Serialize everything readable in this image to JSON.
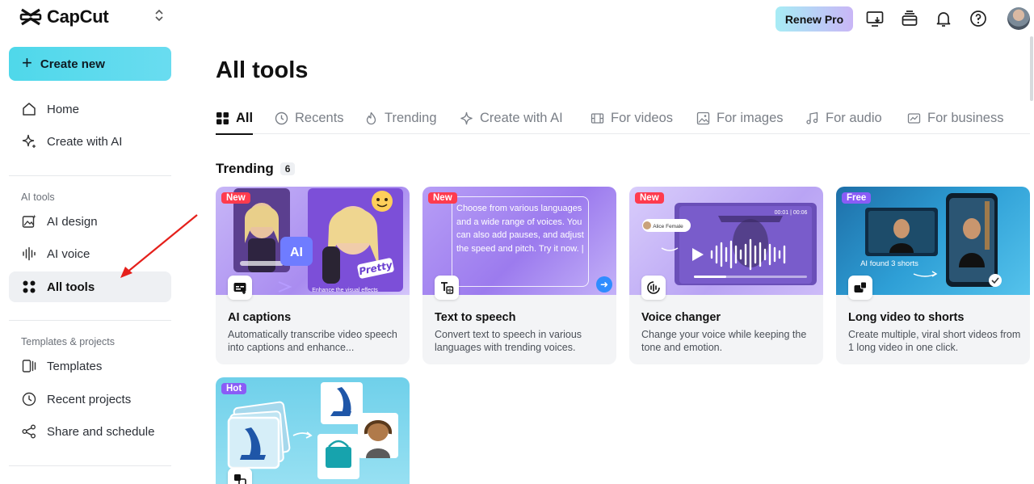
{
  "app": {
    "name": "CapCut"
  },
  "sidebar": {
    "create_label": "Create new",
    "items_top": [
      {
        "label": "Home",
        "icon": "home-icon"
      },
      {
        "label": "Create with AI",
        "icon": "sparkle-icon"
      }
    ],
    "ai_section": "AI tools",
    "ai_items": [
      {
        "label": "AI design",
        "icon": "image-sparkle-icon"
      },
      {
        "label": "AI voice",
        "icon": "waveform-icon"
      },
      {
        "label": "All tools",
        "icon": "grid-icon",
        "active": true
      }
    ],
    "templates_section": "Templates & projects",
    "template_items": [
      {
        "label": "Templates",
        "icon": "template-icon"
      },
      {
        "label": "Recent projects",
        "icon": "clock-icon"
      },
      {
        "label": "Share and schedule",
        "icon": "share-icon"
      }
    ]
  },
  "topbar": {
    "renew_label": "Renew Pro",
    "icons": [
      "download-monitor-icon",
      "stack-icon",
      "bell-icon",
      "help-icon",
      "avatar"
    ]
  },
  "main": {
    "title": "All tools",
    "tabs": [
      {
        "label": "All",
        "icon": "grid-icon",
        "active": true
      },
      {
        "label": "Recents",
        "icon": "clock-icon"
      },
      {
        "label": "Trending",
        "icon": "flame-icon"
      },
      {
        "label": "Create with AI",
        "icon": "sparkle-icon"
      },
      {
        "label": "For videos",
        "icon": "film-icon"
      },
      {
        "label": "For images",
        "icon": "image-icon"
      },
      {
        "label": "For audio",
        "icon": "music-icon"
      },
      {
        "label": "For business",
        "icon": "business-icon"
      }
    ],
    "section": {
      "title": "Trending",
      "count": "6"
    },
    "cards": [
      {
        "badge": "New",
        "title": "AI captions",
        "desc": "Automatically transcribe video speech into captions and enhance..."
      },
      {
        "badge": "New",
        "title": "Text to speech",
        "desc": "Convert text to speech in various languages with trending voices."
      },
      {
        "badge": "New",
        "title": "Voice changer",
        "desc": "Change your voice while keeping the tone and emotion."
      },
      {
        "badge": "Free",
        "title": "Long video to shorts",
        "desc": "Create multiple, viral short videos from 1 long video in one click."
      },
      {
        "badge": "Hot",
        "title": "",
        "desc": ""
      }
    ],
    "card_art": {
      "tts_text": "Choose from various languages and a wide range of voices. You can also add pauses, and adjust the speed and pitch. Try it now. |",
      "ai_chip": "AI",
      "pretty_text": "Pretty",
      "enhance_caption": "Enhance the visual effects",
      "voice_name": "Alice Female",
      "voice_time": "00:01 | 00:06",
      "shorts_label": "AI found 3 shorts"
    }
  },
  "colors": {
    "accent_cyan": "#4fd8ea",
    "badge_new": "#ff3b4e",
    "badge_free": "#8a5cf6",
    "badge_hot": "#8a5cf6",
    "annotation_red": "#e5201b"
  }
}
